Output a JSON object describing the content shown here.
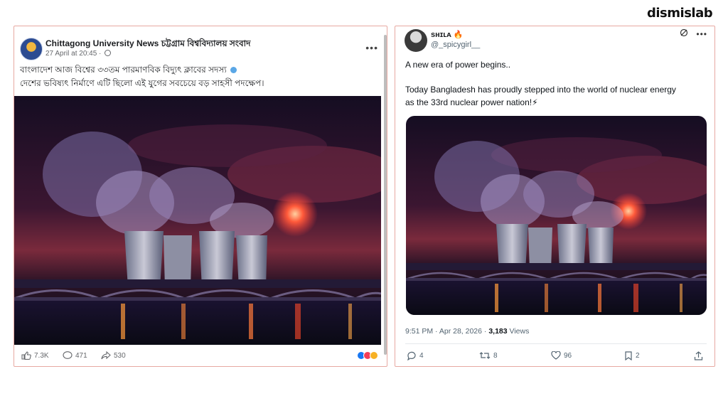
{
  "brand": {
    "logo_text": "dismislab"
  },
  "facebook_post": {
    "page_name": "Chittagong University News চট্টগ্রাম বিশ্ববিদ্যালয় সংবাদ",
    "timestamp": "27 April at 20:45 ·",
    "text_line_1": "বাংলাদেশ আজ বিশ্বের ৩৩তম পারমাণবিক বিদ্যুৎ ক্লাবের সদস্য",
    "text_line_2": "দেশের ভবিষ্যৎ নির্মাণে এটি ছিলো এই যুগের সবচেয়ে বড় সাহসী পদক্ষেপ।",
    "likes": "7.3K",
    "comments": "471",
    "shares": "530",
    "more_icon": "more-horizontal-icon",
    "accent": "#1877f2"
  },
  "tweet": {
    "display_name": "sʜɪʟᴀ 🔥",
    "handle": "@_spicygirl__",
    "line_1": "A new era of power begins..",
    "line_2": "Today Bangladesh has proudly stepped into the world of nuclear energy",
    "line_3": "as the 33rd nuclear power nation!⚡",
    "time_date": "9:51 PM · Apr 28, 2026 · ",
    "views_count": "3,183",
    "views_label": " Views",
    "replies": "4",
    "retweets": "8",
    "likes": "96",
    "bookmarks": "2",
    "accent": "#1d9bf0"
  },
  "frame_color": "#e7a9a2"
}
